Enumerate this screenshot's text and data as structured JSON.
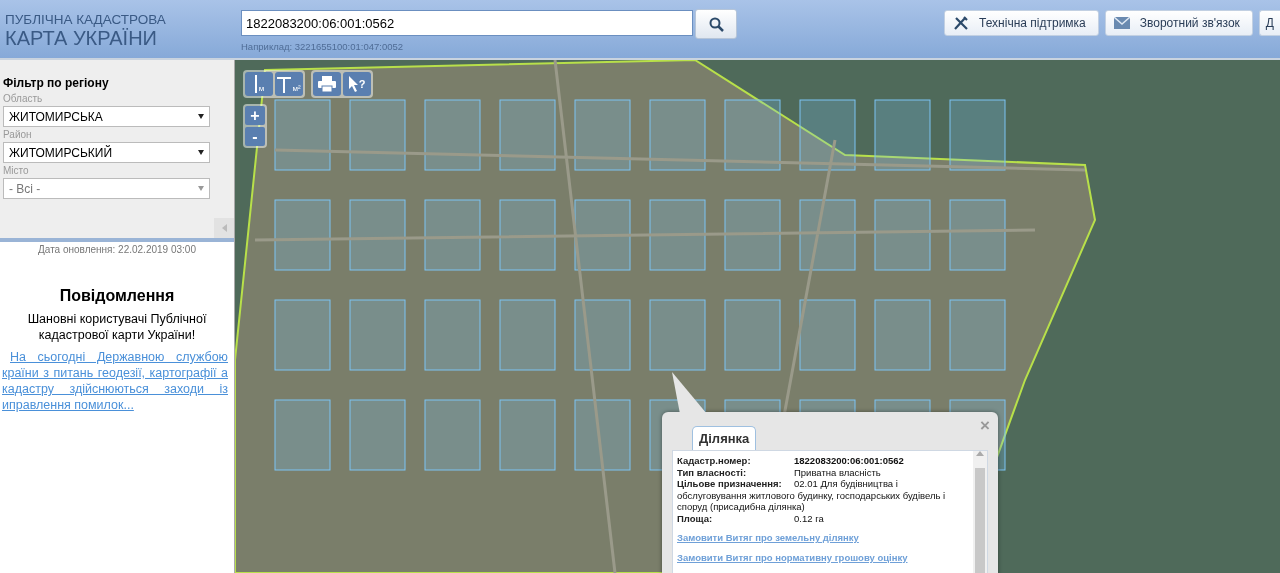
{
  "header": {
    "logo_top": "ПУБЛІЧНА КАДАСТРОВА",
    "logo_bottom": "КАРТА УКРАЇНИ",
    "search": {
      "value": "1822083200:06:001:0562",
      "hint": "Наприклад: 3221655100:01:047:0052"
    },
    "buttons": [
      {
        "label": "Технічна підтримка",
        "kind": "tools"
      },
      {
        "label": "Зворотний зв'язок",
        "kind": "mail"
      },
      {
        "label": "Д",
        "kind": "plain"
      }
    ]
  },
  "sidebar": {
    "title": "Фільтр по регіону",
    "filters": [
      {
        "label": "Область",
        "value": "ЖИТОМИРСЬКА",
        "disabled": false
      },
      {
        "label": "Район",
        "value": "ЖИТОМИРСЬКИЙ",
        "disabled": false
      },
      {
        "label": "Місто",
        "value": "- Всі -",
        "disabled": true
      }
    ],
    "updated": "Дата оновлення: 22.02.2019 03:00",
    "notice": {
      "title": "Повідомлення",
      "greeting": "Шановні користувачі Публічної кадастрової карти України!",
      "link": "На сьогодні Державною службою країни з питань геодезії, картографії а кадастру здійснюються заходи із иправлення помилок..."
    }
  },
  "map": {
    "tools": [
      {
        "kind": "ruler",
        "label": "м"
      },
      {
        "kind": "area",
        "label": "м²"
      },
      {
        "kind": "print"
      },
      {
        "kind": "info",
        "label": "?"
      }
    ],
    "zoom": [
      "+",
      "-"
    ],
    "popup": {
      "tabs": [
        {
          "label": "Ділянка",
          "selected": true
        }
      ],
      "fields": [
        {
          "label": "Кадастр.номер:",
          "value": "1822083200:06:001:0562",
          "bold": true
        },
        {
          "label": "Тип власності:",
          "value": "Приватна власність",
          "bold": false
        },
        {
          "label": "Цільове призначення:",
          "value": "02.01 Для будівництва і обслуговування житлового будинку, господарських будівель і споруд (присадибна ділянка)",
          "bold": false
        },
        {
          "label": "Площа:",
          "value": "0.12 га",
          "bold": false
        }
      ],
      "links": [
        "Замовити Витяг про земельну ділянку",
        "Замовити Витяг про нормативну грошову оцінку"
      ],
      "close": "×"
    }
  }
}
